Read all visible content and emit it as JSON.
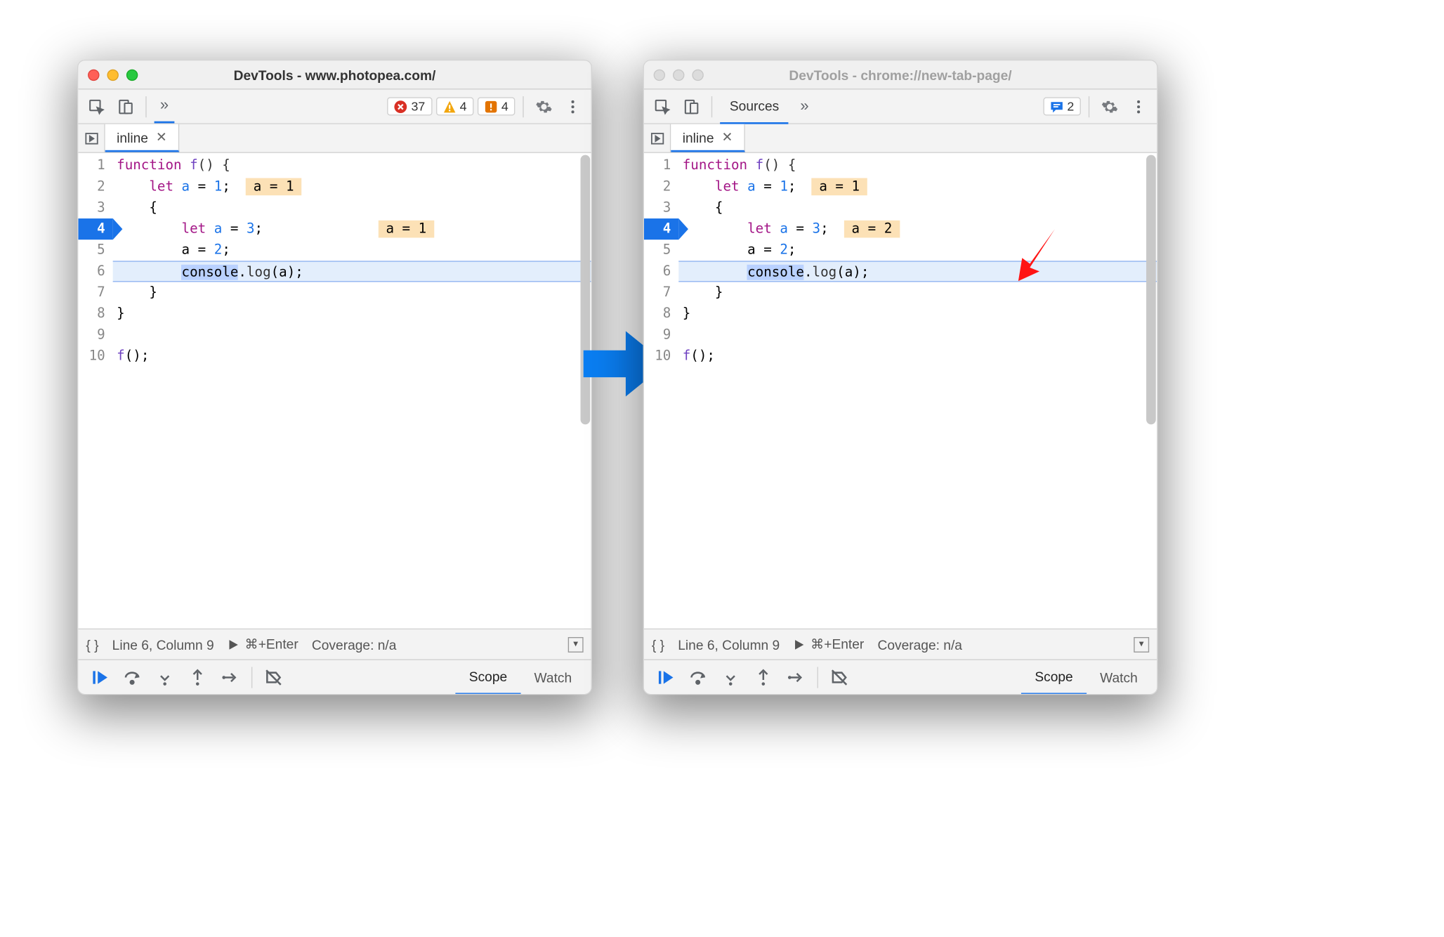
{
  "windows": {
    "left": {
      "active": true,
      "title": "DevTools - www.photopea.com/",
      "show_sources_tab": false,
      "badges": {
        "error_count": "37",
        "warn_count": "4",
        "issue_count": "4",
        "feedback_count": "",
        "show_error": true,
        "show_warn": true,
        "show_issue": true,
        "show_feedback": false
      }
    },
    "right": {
      "active": false,
      "title": "DevTools - chrome://new-tab-page/",
      "show_sources_tab": true,
      "sources_label": "Sources",
      "badges": {
        "feedback_count": "2",
        "show_error": false,
        "show_warn": false,
        "show_issue": false,
        "show_feedback": true
      }
    }
  },
  "file_tab": {
    "name": "inline"
  },
  "code": {
    "exec_line": 4,
    "paused_line": 6,
    "lines": [
      "1",
      "2",
      "3",
      "4",
      "5",
      "6",
      "7",
      "8",
      "9",
      "10"
    ],
    "tokens": {
      "l1_a": "function ",
      "l1_b": "f",
      "l1_c": "() {",
      "l2_a": "    ",
      "l2_b": "let ",
      "l2_c": "a",
      "l2_d": " = ",
      "l2_e": "1",
      "l2_f": ";",
      "l3_a": "    {",
      "l4_a": "        ",
      "l4_b": "let ",
      "l4_c": "a",
      "l4_d": " = ",
      "l4_e": "3",
      "l4_f": ";",
      "l5_a": "        a = ",
      "l5_b": "2",
      "l5_c": ";",
      "l6_a": "        ",
      "l6_b": "console",
      "l6_c": ".",
      "l6_d": "log",
      "l6_e": "(a);",
      "l7_a": "    }",
      "l8_a": "}",
      "l10_a": "f",
      "l10_b": "();"
    },
    "hints": {
      "left_l2": "a = 1",
      "left_l4": "a = 1",
      "right_l2": "a = 1",
      "right_l4": "a = 2"
    }
  },
  "statusbar": {
    "braces": "{ }",
    "position": "Line 6, Column 9",
    "run_hint": "⌘+Enter",
    "coverage": "Coverage: n/a"
  },
  "debug_tabs": {
    "scope": "Scope",
    "watch": "Watch"
  },
  "icons": {
    "inspect": "inspect-icon",
    "device": "device-icon",
    "gear": "gear-icon",
    "kebab": "kebab-icon",
    "play": "play-icon",
    "resume": "resume-icon",
    "step_over": "step-over-icon",
    "step_into": "step-into-icon",
    "step_out": "step-out-icon",
    "step": "step-icon",
    "deactivate": "deactivate-breakpoints-icon"
  }
}
